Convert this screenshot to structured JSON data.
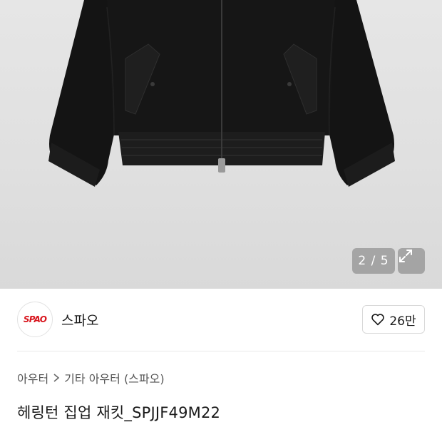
{
  "gallery": {
    "counter": "2 / 5"
  },
  "brand": {
    "logo_text": "SPAO",
    "name": "스파오",
    "likes": "26만"
  },
  "breadcrumb": {
    "items": [
      "아우터",
      "기타 아우터 (스파오)"
    ]
  },
  "product": {
    "title": "헤링턴 집업 재킷_SPJJF49M22"
  },
  "colors": {
    "brand_red": "#d8141c",
    "text_primary": "#1a1a1a",
    "text_secondary": "#555555"
  },
  "icons": [
    "expand-icon",
    "heart-icon",
    "chevron-right-icon"
  ]
}
